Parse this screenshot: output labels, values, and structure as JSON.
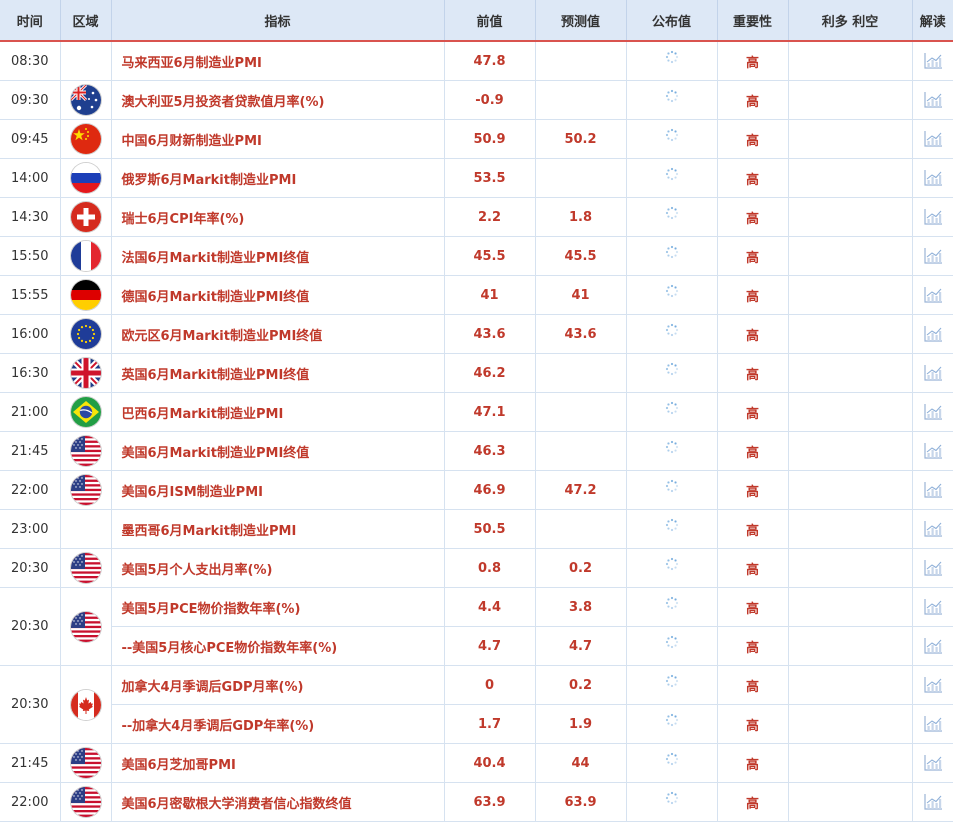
{
  "headers": {
    "time": "时间",
    "region": "区域",
    "indicator": "指标",
    "previous": "前值",
    "forecast": "预测值",
    "actual": "公布值",
    "importance": "重要性",
    "effect": "利多 利空",
    "explain": "解读"
  },
  "rows": [
    {
      "time": "08:30",
      "flag": "none",
      "indicator": "马来西亚6月制造业PMI",
      "previous": "47.8",
      "forecast": "",
      "importance": "高"
    },
    {
      "time": "09:30",
      "flag": "australia-flag-icon",
      "indicator": "澳大利亚5月投资者贷款值月率(%)",
      "previous": "-0.9",
      "forecast": "",
      "importance": "高"
    },
    {
      "time": "09:45",
      "flag": "china-flag-icon",
      "indicator": "中国6月财新制造业PMI",
      "previous": "50.9",
      "forecast": "50.2",
      "importance": "高"
    },
    {
      "time": "14:00",
      "flag": "russia-flag-icon",
      "indicator": "俄罗斯6月Markit制造业PMI",
      "previous": "53.5",
      "forecast": "",
      "importance": "高"
    },
    {
      "time": "14:30",
      "flag": "switzerland-flag-icon",
      "indicator": "瑞士6月CPI年率(%)",
      "previous": "2.2",
      "forecast": "1.8",
      "importance": "高"
    },
    {
      "time": "15:50",
      "flag": "france-flag-icon",
      "indicator": "法国6月Markit制造业PMI终值",
      "previous": "45.5",
      "forecast": "45.5",
      "importance": "高"
    },
    {
      "time": "15:55",
      "flag": "germany-flag-icon",
      "indicator": "德国6月Markit制造业PMI终值",
      "previous": "41",
      "forecast": "41",
      "importance": "高"
    },
    {
      "time": "16:00",
      "flag": "eu-flag-icon",
      "indicator": "欧元区6月Markit制造业PMI终值",
      "previous": "43.6",
      "forecast": "43.6",
      "importance": "高"
    },
    {
      "time": "16:30",
      "flag": "uk-flag-icon",
      "indicator": "英国6月Markit制造业PMI终值",
      "previous": "46.2",
      "forecast": "",
      "importance": "高"
    },
    {
      "time": "21:00",
      "flag": "brazil-flag-icon",
      "indicator": "巴西6月Markit制造业PMI",
      "previous": "47.1",
      "forecast": "",
      "importance": "高"
    },
    {
      "time": "21:45",
      "flag": "usa-flag-icon",
      "indicator": "美国6月Markit制造业PMI终值",
      "previous": "46.3",
      "forecast": "",
      "importance": "高"
    },
    {
      "time": "22:00",
      "flag": "usa-flag-icon",
      "indicator": "美国6月ISM制造业PMI",
      "previous": "46.9",
      "forecast": "47.2",
      "importance": "高"
    },
    {
      "time": "23:00",
      "flag": "none",
      "indicator": "墨西哥6月Markit制造业PMI",
      "previous": "50.5",
      "forecast": "",
      "importance": "高"
    },
    {
      "time": "20:30",
      "flag": "usa-flag-icon",
      "indicator": "美国5月个人支出月率(%)",
      "previous": "0.8",
      "forecast": "0.2",
      "importance": "高"
    },
    {
      "time": "20:30",
      "flag": "usa-flag-icon",
      "indicator": "美国5月PCE物价指数年率(%)",
      "previous": "4.4",
      "forecast": "3.8",
      "importance": "高",
      "span": 2
    },
    {
      "indicator": "--美国5月核心PCE物价指数年率(%)",
      "previous": "4.7",
      "forecast": "4.7",
      "importance": "高",
      "cont": true
    },
    {
      "time": "20:30",
      "flag": "canada-flag-icon",
      "indicator": "加拿大4月季调后GDP月率(%)",
      "previous": "0",
      "forecast": "0.2",
      "importance": "高",
      "span": 2
    },
    {
      "indicator": "--加拿大4月季调后GDP年率(%)",
      "previous": "1.7",
      "forecast": "1.9",
      "importance": "高",
      "cont": true
    },
    {
      "time": "21:45",
      "flag": "usa-flag-icon",
      "indicator": "美国6月芝加哥PMI",
      "previous": "40.4",
      "forecast": "44",
      "importance": "高"
    },
    {
      "time": "22:00",
      "flag": "usa-flag-icon",
      "indicator": "美国6月密歇根大学消费者信心指数终值",
      "previous": "63.9",
      "forecast": "63.9",
      "importance": "高"
    }
  ],
  "icons": {
    "actual": "loading-spinner-icon",
    "explain": "chart-icon"
  },
  "colors": {
    "value_red": "#c0392b",
    "header_bg": "#dde8f6",
    "header_border": "#d9534f"
  }
}
